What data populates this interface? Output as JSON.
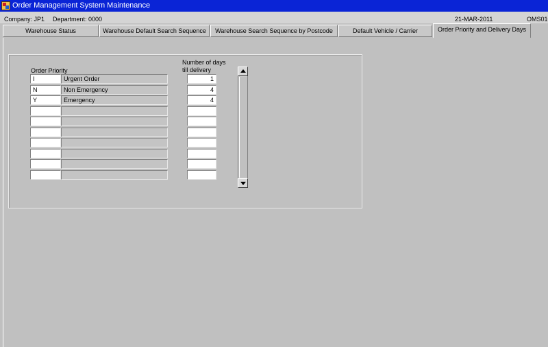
{
  "window": {
    "title": "Order Management System Maintenance"
  },
  "infobar": {
    "company": "Company:  JP1",
    "department": "Department:  0000",
    "date": "21-MAR-2011",
    "module_code": "OMS010"
  },
  "tabs": [
    {
      "label": "Warehouse Status",
      "active": false
    },
    {
      "label": "Warehouse Default Search Sequence",
      "active": false
    },
    {
      "label": "Warehouse Search Sequence by Postcode",
      "active": false
    },
    {
      "label": "Default Vehicle / Carrier",
      "active": false
    },
    {
      "label": "Order Priority and Delivery Days",
      "active": true
    }
  ],
  "form": {
    "order_priority_label": "Order Priority",
    "days_label_line1": "Number of days",
    "days_label_line2": "till delivery",
    "rows": [
      {
        "code": "I",
        "description": "Urgent Order",
        "days": "1"
      },
      {
        "code": "N",
        "description": "Non Emergency",
        "days": "4"
      },
      {
        "code": "Y",
        "description": "Emergency",
        "days": "4"
      },
      {
        "code": "",
        "description": "",
        "days": ""
      },
      {
        "code": "",
        "description": "",
        "days": ""
      },
      {
        "code": "",
        "description": "",
        "days": ""
      },
      {
        "code": "",
        "description": "",
        "days": ""
      },
      {
        "code": "",
        "description": "",
        "days": ""
      },
      {
        "code": "",
        "description": "",
        "days": ""
      },
      {
        "code": "",
        "description": "",
        "days": ""
      }
    ]
  },
  "icons": {
    "app": "app-window-icon",
    "scroll_up": "arrow-up-icon",
    "scroll_down": "arrow-down-icon"
  }
}
